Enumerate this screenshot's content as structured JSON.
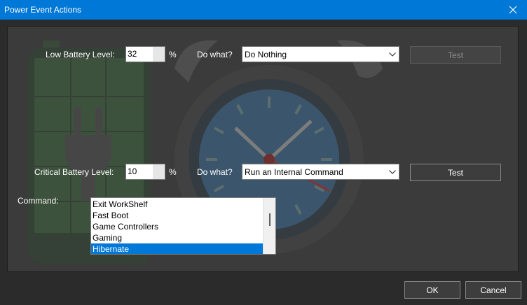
{
  "window": {
    "title": "Power Event Actions"
  },
  "low_battery": {
    "label": "Low Battery Level:",
    "value": "32",
    "unit": "%",
    "do_what_label": "Do what?",
    "action": "Do Nothing",
    "test_label": "Test"
  },
  "critical_battery": {
    "label": "Critical Battery Level:",
    "value": "10",
    "unit": "%",
    "do_what_label": "Do what?",
    "action": "Run an Internal Command",
    "test_label": "Test"
  },
  "command": {
    "label": "Command:",
    "items": [
      "Exit WorkShelf",
      "Fast Boot",
      "Game Controllers",
      "Gaming",
      "Hibernate"
    ],
    "selected": "Hibernate"
  },
  "footer": {
    "ok_label": "OK",
    "cancel_label": "Cancel"
  }
}
